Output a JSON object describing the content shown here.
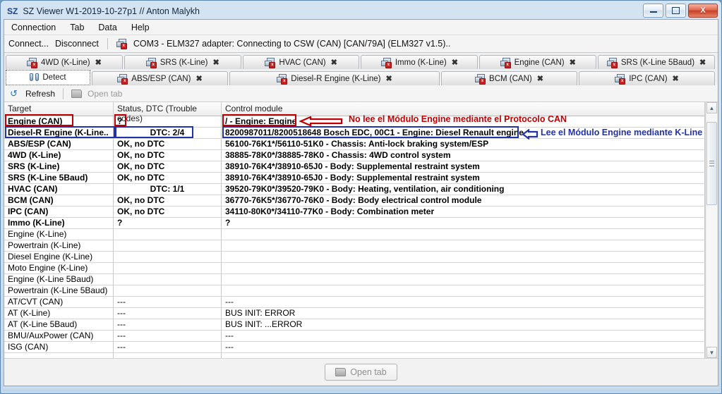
{
  "window": {
    "logo": "SZ",
    "title": "SZ Viewer W1-2019-10-27p1 // Anton Malykh",
    "minimize_label": "─",
    "maximize_label": "□",
    "close_label": "X"
  },
  "menubar": {
    "items": [
      "Connection",
      "Tab",
      "Data",
      "Help"
    ]
  },
  "toolbar": {
    "connect_label": "Connect...",
    "disconnect_label": "Disconnect",
    "status_text": "COM3 - ELM327 adapter: Connecting to CSW (CAN) [CAN/79A] (ELM327 v1.5)..",
    "adapter_icon": "adapter-disconnected-icon"
  },
  "tabs": {
    "row1": [
      {
        "label": "4WD (K-Line)",
        "icon": "module-icon",
        "close": "✖",
        "active": false
      },
      {
        "label": "SRS (K-Line)",
        "icon": "module-icon",
        "close": "✖",
        "active": false
      },
      {
        "label": "HVAC (CAN)",
        "icon": "module-icon",
        "close": "✖",
        "active": false
      },
      {
        "label": "Immo (K-Line)",
        "icon": "module-icon",
        "close": "✖",
        "active": false
      },
      {
        "label": "Engine (CAN)",
        "icon": "module-icon",
        "close": "✖",
        "active": false
      },
      {
        "label": "SRS (K-Line 5Baud)",
        "icon": "module-icon",
        "close": "✖",
        "active": false
      }
    ],
    "row2": [
      {
        "label": "Detect",
        "icon": "detect-icon",
        "close": "",
        "active": true
      },
      {
        "label": "ABS/ESP (CAN)",
        "icon": "module-icon",
        "close": "✖",
        "active": false
      },
      {
        "label": "Diesel-R Engine (K-Line)",
        "icon": "module-icon",
        "close": "✖",
        "active": false
      },
      {
        "label": "BCM (CAN)",
        "icon": "module-icon",
        "close": "✖",
        "active": false
      },
      {
        "label": "IPC (CAN)",
        "icon": "module-icon",
        "close": "✖",
        "active": false
      }
    ]
  },
  "grid_toolbar": {
    "refresh_label": "Refresh",
    "refresh_icon": "refresh-icon",
    "open_tab_label": "Open tab",
    "open_tab_icon": "folder-icon"
  },
  "table": {
    "headers": [
      "Target",
      "Status, DTC (Trouble codes)",
      "Control module"
    ],
    "rows": [
      {
        "target": "Engine (CAN)",
        "status": "?",
        "module": "/ - Engine: Engine",
        "bold": true,
        "status_center": false
      },
      {
        "target": "Diesel-R Engine (K-Line..",
        "status": "DTC: 2/4",
        "module": "8200987011/8200518648 Bosch EDC, 00C1 - Engine: Diesel Renault engine",
        "bold": true,
        "status_center": true
      },
      {
        "target": "ABS/ESP (CAN)",
        "status": "OK, no DTC",
        "module": "56100-76K1*/56110-51K0 - Chassis: Anti-lock braking system/ESP",
        "bold": true,
        "status_center": false
      },
      {
        "target": "4WD (K-Line)",
        "status": "OK, no DTC",
        "module": "38885-78K0*/38885-78K0 - Chassis: 4WD control system",
        "bold": true,
        "status_center": false
      },
      {
        "target": "SRS (K-Line)",
        "status": "OK, no DTC",
        "module": "38910-76K4*/38910-65J0 - Body: Supplemental restraint system",
        "bold": true,
        "status_center": false
      },
      {
        "target": "SRS (K-Line 5Baud)",
        "status": "OK, no DTC",
        "module": "38910-76K4*/38910-65J0 - Body: Supplemental restraint system",
        "bold": true,
        "status_center": false
      },
      {
        "target": "HVAC (CAN)",
        "status": "DTC: 1/1",
        "module": "39520-79K0*/39520-79K0 - Body: Heating, ventilation, air conditioning",
        "bold": true,
        "status_center": true
      },
      {
        "target": "BCM (CAN)",
        "status": "OK, no DTC",
        "module": "36770-76K5*/36770-76K0 - Body: Body electrical control module",
        "bold": true,
        "status_center": false
      },
      {
        "target": "IPC (CAN)",
        "status": "OK, no DTC",
        "module": "34110-80K0*/34110-77K0 - Body: Combination meter",
        "bold": true,
        "status_center": false
      },
      {
        "target": "Immo (K-Line)",
        "status": "?",
        "module": "?",
        "bold": true,
        "status_center": false
      },
      {
        "target": "Engine (K-Line)",
        "status": "",
        "module": "",
        "bold": false,
        "status_center": false
      },
      {
        "target": "Powertrain (K-Line)",
        "status": "",
        "module": "",
        "bold": false,
        "status_center": false
      },
      {
        "target": "Diesel Engine (K-Line)",
        "status": "",
        "module": "",
        "bold": false,
        "status_center": false
      },
      {
        "target": "Moto Engine (K-Line)",
        "status": "",
        "module": "",
        "bold": false,
        "status_center": false
      },
      {
        "target": "Engine (K-Line 5Baud)",
        "status": "",
        "module": "",
        "bold": false,
        "status_center": false
      },
      {
        "target": "Powertrain (K-Line 5Baud)",
        "status": "",
        "module": "",
        "bold": false,
        "status_center": false
      },
      {
        "target": "AT/CVT (CAN)",
        "status": "---",
        "module": "---",
        "bold": false,
        "status_center": false
      },
      {
        "target": "AT (K-Line)",
        "status": "---",
        "module": "BUS INIT: ERROR",
        "bold": false,
        "status_center": false
      },
      {
        "target": "AT (K-Line 5Baud)",
        "status": "---",
        "module": "BUS INIT: ...ERROR",
        "bold": false,
        "status_center": false
      },
      {
        "target": "BMU/AuxPower (CAN)",
        "status": "---",
        "module": "---",
        "bold": false,
        "status_center": false
      },
      {
        "target": "ISG (CAN)",
        "status": "---",
        "module": "---",
        "bold": false,
        "status_center": false
      },
      {
        "target": "",
        "status": "",
        "module": "",
        "bold": false,
        "status_center": false
      }
    ]
  },
  "annotations": {
    "red_note": "No lee el Módulo Engine mediante el Protocolo CAN",
    "blue_note": "Lee el Módulo Engine mediante K-Line",
    "red_arrow_icon": "arrow-left-red-icon",
    "blue_arrow_icon": "arrow-left-blue-icon",
    "red_color": "#c00000",
    "blue_color": "#2233aa"
  },
  "footer": {
    "open_tab_label": "Open tab",
    "open_tab_icon": "folder-icon"
  },
  "scrollbar": {
    "up_arrow": "▲",
    "down_arrow": "▼"
  }
}
